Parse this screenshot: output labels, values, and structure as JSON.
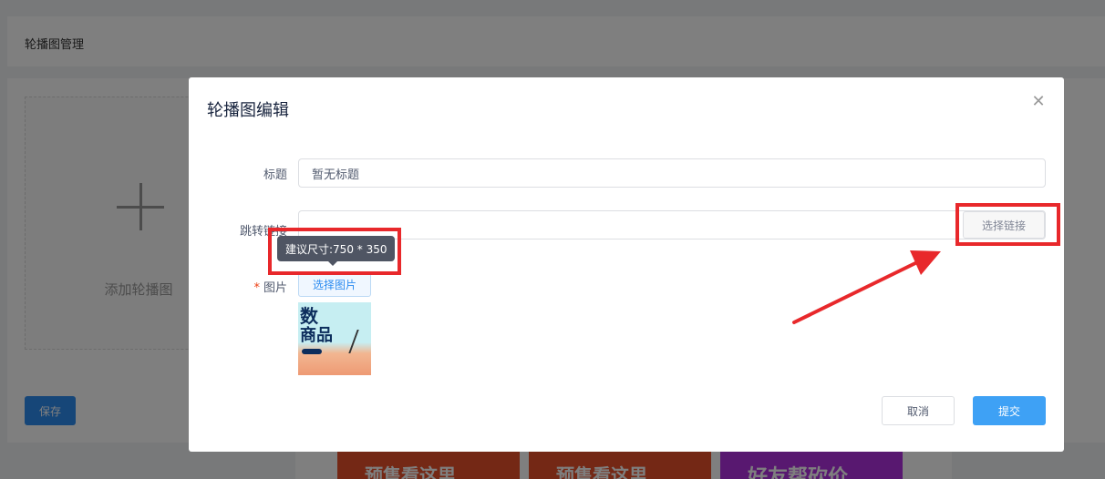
{
  "page": {
    "title": "轮播图管理",
    "add_label": "添加轮播图",
    "save_label": "保存",
    "thumbs": [
      "预售看这里",
      "预售看这里",
      "好友帮砍价"
    ]
  },
  "modal": {
    "title": "轮播图编辑",
    "close_icon": "close-icon",
    "fields": {
      "title_label": "标题",
      "title_value": "暂无标题",
      "link_label": "跳转链接",
      "link_value": "",
      "pick_link_label": "选择链接",
      "image_label": "图片",
      "image_required_mark": "*",
      "pick_image_label": "选择图片"
    },
    "preview_text": [
      "数",
      "商品"
    ],
    "tooltip": "建议尺寸:750 * 350",
    "cancel_label": "取消",
    "submit_label": "提交"
  },
  "colors": {
    "primary": "#3ea1f5",
    "annotation": "#e8282b"
  }
}
